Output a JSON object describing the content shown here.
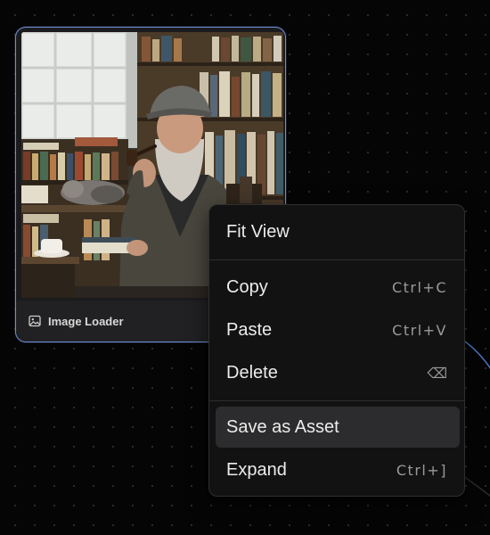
{
  "node": {
    "title": "Image Loader",
    "icon": "image-icon",
    "image_alt": "Photo of an elderly bearded man with a pipe in a bookshop"
  },
  "context_menu": {
    "items": [
      {
        "label": "Fit View",
        "shortcut": ""
      },
      {
        "label": "Copy",
        "shortcut": "Ctrl+C"
      },
      {
        "label": "Paste",
        "shortcut": "Ctrl+V"
      },
      {
        "label": "Delete",
        "shortcut": "⌫",
        "shortcut_icon": "backspace-icon"
      },
      {
        "label": "Save as Asset",
        "shortcut": "",
        "highlighted": true
      },
      {
        "label": "Expand",
        "shortcut": "Ctrl+]"
      }
    ]
  },
  "colors": {
    "canvas_background": "#050505",
    "node_border": "#6f8fd4",
    "menu_background": "#121212",
    "menu_highlight": "#2c2c2e",
    "edge": "#4a79c8"
  }
}
